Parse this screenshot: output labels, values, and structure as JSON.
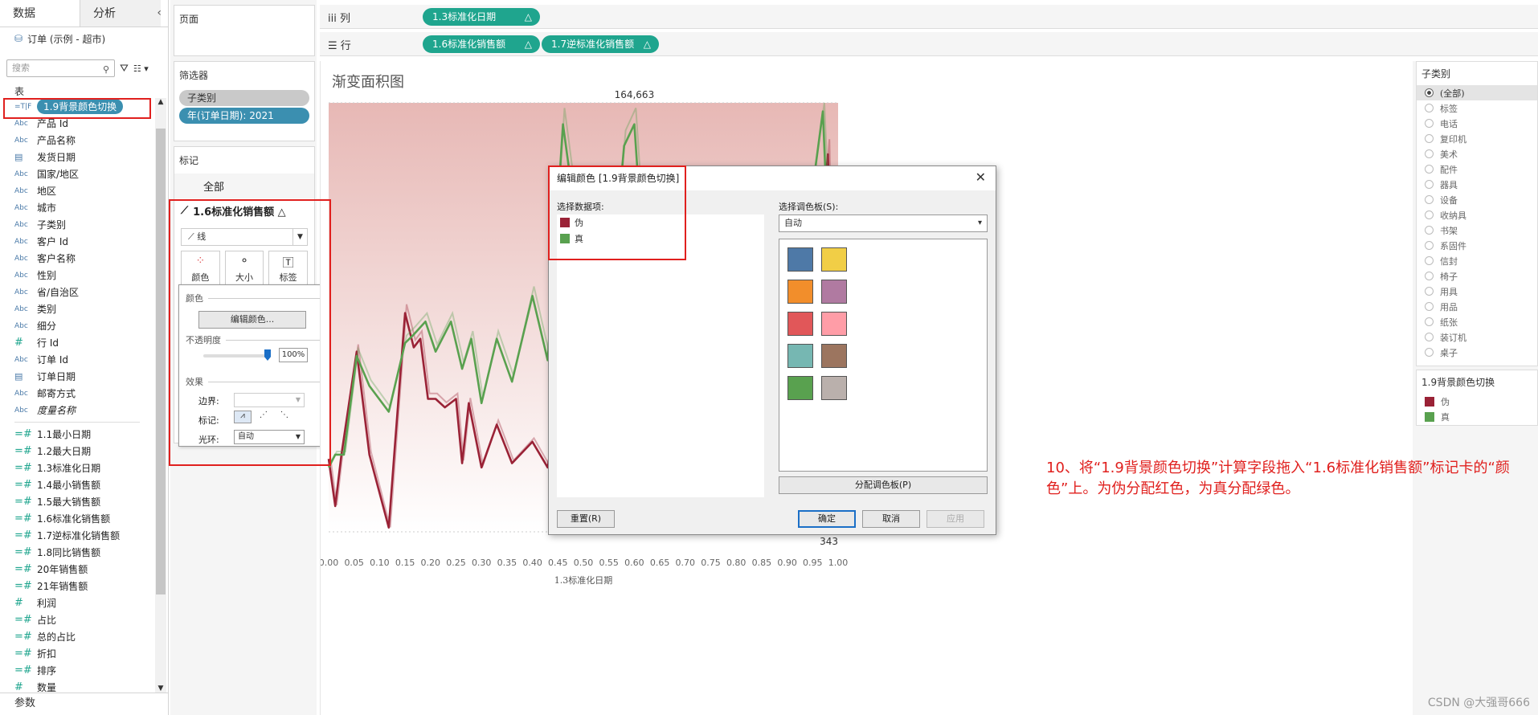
{
  "data_pane": {
    "tabs": [
      "数据",
      "分析"
    ],
    "collapse": "‹",
    "datasource": "订单 (示例 - 超市)",
    "search_placeholder": "搜索",
    "section_table": "表",
    "fields": [
      {
        "type": "=T|F",
        "label": "1.9背景颜色切换",
        "selected": true
      },
      {
        "type": "Abc",
        "label": "产品 Id"
      },
      {
        "type": "Abc",
        "label": "产品名称"
      },
      {
        "type": "cal",
        "label": "发货日期"
      },
      {
        "type": "Abc",
        "label": "国家/地区"
      },
      {
        "type": "Abc",
        "label": "地区"
      },
      {
        "type": "Abc",
        "label": "城市"
      },
      {
        "type": "Abc",
        "label": "子类别"
      },
      {
        "type": "Abc",
        "label": "客户 Id"
      },
      {
        "type": "Abc",
        "label": "客户名称"
      },
      {
        "type": "Abc",
        "label": "性别"
      },
      {
        "type": "Abc",
        "label": "省/自治区"
      },
      {
        "type": "Abc",
        "label": "类别"
      },
      {
        "type": "Abc",
        "label": "细分"
      },
      {
        "type": "#",
        "label": "行 Id"
      },
      {
        "type": "Abc",
        "label": "订单 Id"
      },
      {
        "type": "cal",
        "label": "订单日期"
      },
      {
        "type": "Abc",
        "label": "邮寄方式"
      },
      {
        "type": "Abc",
        "label": "度量名称",
        "italic": true
      }
    ],
    "measures": [
      {
        "type": "=#",
        "label": "1.1最小日期"
      },
      {
        "type": "=#",
        "label": "1.2最大日期"
      },
      {
        "type": "=#",
        "label": "1.3标准化日期"
      },
      {
        "type": "=#",
        "label": "1.4最小销售额"
      },
      {
        "type": "=#",
        "label": "1.5最大销售额"
      },
      {
        "type": "=#",
        "label": "1.6标准化销售额"
      },
      {
        "type": "=#",
        "label": "1.7逆标准化销售额"
      },
      {
        "type": "=#",
        "label": "1.8同比销售额"
      },
      {
        "type": "=#",
        "label": "20年销售额"
      },
      {
        "type": "=#",
        "label": "21年销售额"
      },
      {
        "type": "#",
        "label": "利润"
      },
      {
        "type": "=#",
        "label": "占比"
      },
      {
        "type": "=#",
        "label": "总的占比"
      },
      {
        "type": "=#",
        "label": "折扣"
      },
      {
        "type": "=#",
        "label": "排序"
      },
      {
        "type": "#",
        "label": "数量"
      }
    ],
    "params_label": "参数"
  },
  "shelves": {
    "pages": "页面",
    "filters_title": "筛选器",
    "filters": [
      "子类别",
      "年(订单日期): 2021"
    ],
    "marks_title": "标记",
    "marks_all": "全部",
    "marks_measure": "1.6标准化销售额 △",
    "mark_type": "线",
    "mark_buttons": [
      "颜色",
      "大小",
      "标签"
    ]
  },
  "color_popup": {
    "color_label": "颜色",
    "edit_button": "编辑颜色...",
    "opacity_label": "不透明度",
    "opacity_value": "100%",
    "effects_label": "效果",
    "border_label": "边界:",
    "markers_label": "标记:",
    "halo_label": "光环:",
    "halo_value": "自动"
  },
  "columns_shelf": {
    "label": "列",
    "pills": [
      "1.3标准化日期"
    ]
  },
  "rows_shelf": {
    "label": "行",
    "pills": [
      "1.6标准化销售额",
      "1.7逆标准化销售额"
    ]
  },
  "pill_delta": "△",
  "chart_data": {
    "type": "area",
    "title": "渐变面积图",
    "xlabel": "1.3标准化日期",
    "ylabel": "",
    "xlim": [
      0,
      1
    ],
    "x_ticks": [
      "0.00",
      "0.05",
      "0.10",
      "0.15",
      "0.20",
      "0.25",
      "0.30",
      "0.35",
      "0.40",
      "0.45",
      "0.50",
      "0.55",
      "0.60",
      "0.65",
      "0.70",
      "0.75",
      "0.80",
      "0.85",
      "0.90",
      "0.95",
      "1.00"
    ],
    "ylim": [
      0,
      1
    ],
    "annotations": [
      {
        "text": "164,663",
        "x": 0.6,
        "y": 1.0
      },
      {
        "text": "343",
        "x": 1.0,
        "y": 0.0
      }
    ],
    "series": [
      {
        "name": "伪",
        "color": "#9a2236",
        "x": [
          0.0,
          0.013,
          0.025,
          0.055,
          0.08,
          0.118,
          0.13,
          0.15,
          0.167,
          0.18,
          0.195,
          0.21,
          0.228,
          0.25,
          0.262,
          0.275,
          0.3,
          0.33,
          0.36,
          0.4,
          0.43,
          0.45,
          0.46,
          0.475,
          0.5,
          0.52,
          0.55,
          0.57,
          0.59,
          0.6,
          0.62,
          0.64,
          0.66,
          0.68,
          0.7,
          0.705,
          0.72,
          0.73,
          0.75,
          0.77,
          0.79,
          0.8,
          0.82,
          0.85,
          0.88,
          0.92,
          0.94,
          0.96,
          0.98,
          1.0
        ],
        "y": [
          0.17,
          0.06,
          0.18,
          0.42,
          0.18,
          0.01,
          0.2,
          0.51,
          0.43,
          0.45,
          0.31,
          0.31,
          0.29,
          0.31,
          0.16,
          0.3,
          0.15,
          0.25,
          0.16,
          0.21,
          0.15,
          0.3,
          0.6,
          0.45,
          0.14,
          0.4,
          0.1,
          0.1,
          0.15,
          0.4,
          0.15,
          0.25,
          0.3,
          0.15,
          0.2,
          0.3,
          0.15,
          0.05,
          0.3,
          0.4,
          0.35,
          0.15,
          0.28,
          0.12,
          0.25,
          0.1,
          0.3,
          0.6,
          0.88,
          0.0
        ]
      },
      {
        "name": "真",
        "color": "#59a14f",
        "x": [
          0.0,
          0.013,
          0.03,
          0.055,
          0.08,
          0.118,
          0.13,
          0.15,
          0.167,
          0.19,
          0.21,
          0.24,
          0.262,
          0.28,
          0.3,
          0.33,
          0.36,
          0.4,
          0.43,
          0.46,
          0.5,
          0.53,
          0.55,
          0.58,
          0.6,
          0.62,
          0.65,
          0.68,
          0.7,
          0.73,
          0.76,
          0.8,
          0.83,
          0.86,
          0.9,
          0.93,
          0.95,
          0.97,
          0.98,
          1.0
        ],
        "y": [
          0.15,
          0.18,
          0.18,
          0.41,
          0.34,
          0.28,
          0.34,
          0.44,
          0.46,
          0.49,
          0.42,
          0.49,
          0.38,
          0.45,
          0.3,
          0.45,
          0.35,
          0.55,
          0.4,
          0.95,
          0.6,
          0.7,
          0.5,
          0.9,
          0.95,
          0.6,
          0.7,
          0.5,
          0.6,
          0.4,
          0.55,
          0.45,
          0.6,
          0.5,
          0.55,
          0.7,
          0.8,
          0.98,
          0.7,
          0.45
        ]
      }
    ]
  },
  "legend_subcat": {
    "title": "子类别",
    "items": [
      "(全部)",
      "标签",
      "电话",
      "复印机",
      "美术",
      "配件",
      "器具",
      "设备",
      "收纳具",
      "书架",
      "系固件",
      "信封",
      "椅子",
      "用具",
      "用品",
      "纸张",
      "装订机",
      "桌子"
    ],
    "selected": 0
  },
  "legend_color": {
    "title": "1.9背景颜色切换",
    "items": [
      {
        "label": "伪",
        "color": "#9a2236"
      },
      {
        "label": "真",
        "color": "#59a14f"
      }
    ]
  },
  "dialog": {
    "title": "编辑颜色 [1.9背景颜色切换]",
    "close": "✕",
    "select_item_label": "选择数据项:",
    "items": [
      {
        "label": "伪",
        "color": "#9a2236"
      },
      {
        "label": "真",
        "color": "#59a14f"
      }
    ],
    "select_palette_label": "选择调色板(S):",
    "palette_value": "自动",
    "palette_colors": [
      "#4e79a7",
      "#f1ce46",
      "#f28e2b",
      "#b07aa1",
      "#e15759",
      "#ff9da7",
      "#76b7b2",
      "#9c755f",
      "#59a14f",
      "#bab0ac"
    ],
    "assign_button": "分配调色板(P)",
    "reset_button": "重置(R)",
    "ok_button": "确定",
    "cancel_button": "取消",
    "apply_button": "应用"
  },
  "annotation_text": "10、将“1.9背景颜色切换”计算字段拖入“1.6标准化销售额”标记卡的“颜色”上。为伪分配红色，为真分配绿色。",
  "watermark": "CSDN @大强哥666"
}
